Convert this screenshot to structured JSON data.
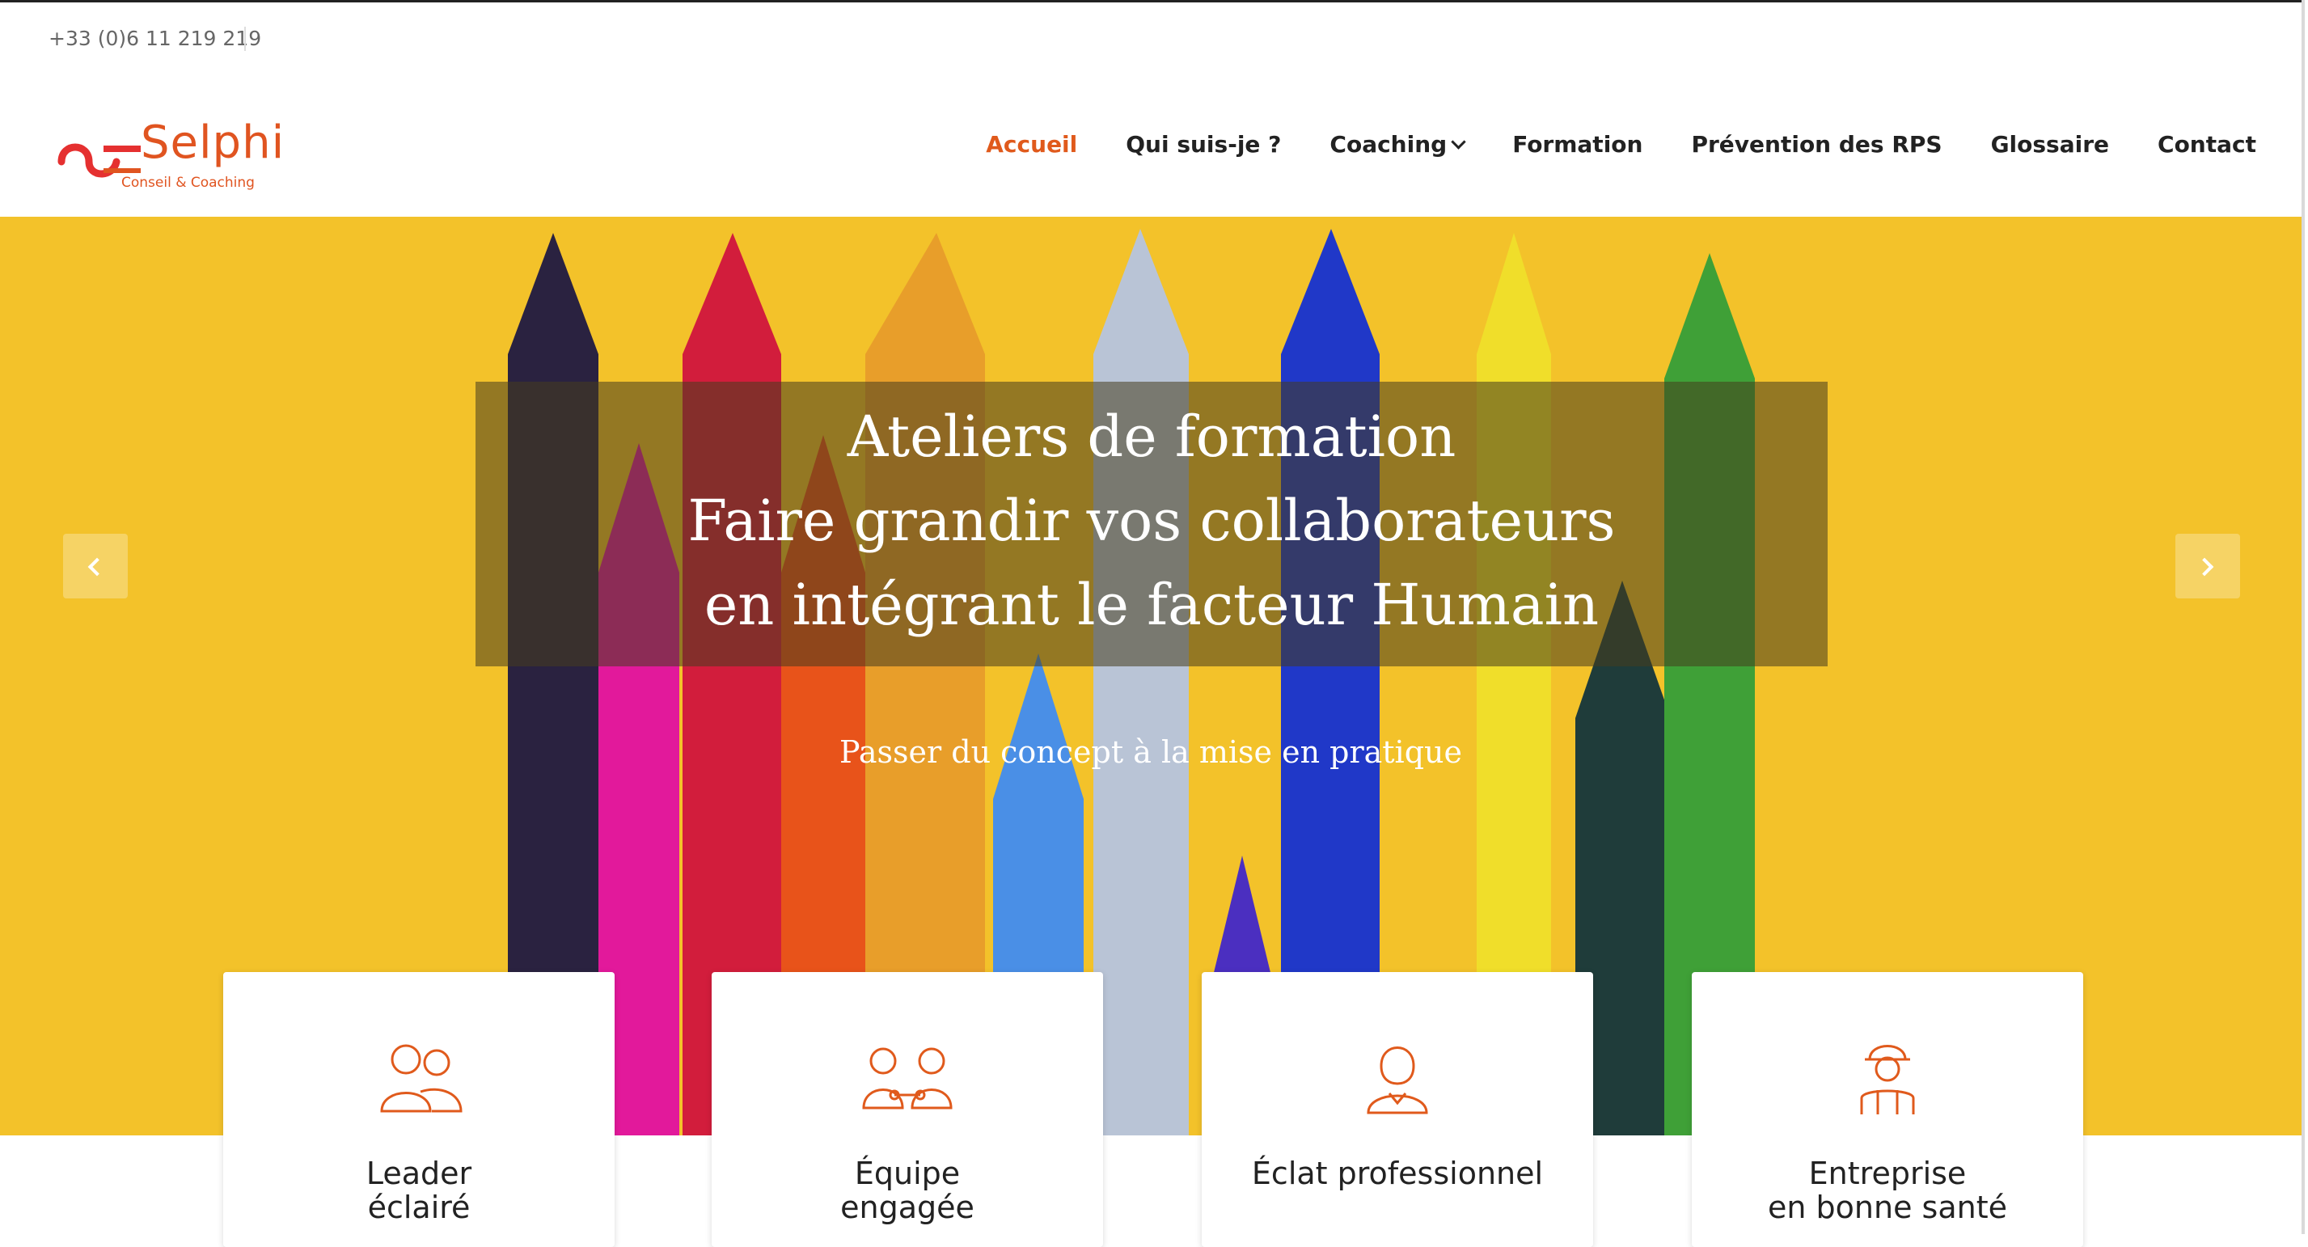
{
  "topbar": {
    "phone": "+33 (0)6 11 219 219"
  },
  "logo": {
    "brand": "Selphi",
    "tagline": "Conseil & Coaching"
  },
  "nav": {
    "items": [
      {
        "label": "Accueil",
        "active": true
      },
      {
        "label": "Qui suis-je ?"
      },
      {
        "label": "Coaching",
        "dropdown": true
      },
      {
        "label": "Formation"
      },
      {
        "label": "Prévention des RPS"
      },
      {
        "label": "Glossaire"
      },
      {
        "label": "Contact"
      }
    ]
  },
  "hero": {
    "title_lines": [
      "Ateliers de formation",
      "Faire grandir vos collaborateurs",
      "en intégrant le facteur Humain"
    ],
    "subtitle": "Passer du concept à la mise en pratique"
  },
  "cards": [
    {
      "title_lines": [
        "Leader",
        "éclairé"
      ],
      "icon": "two-people-icon"
    },
    {
      "title_lines": [
        "Équipe",
        "engagée"
      ],
      "icon": "team-link-icon"
    },
    {
      "title_lines": [
        "Éclat professionnel",
        ""
      ],
      "icon": "woman-icon"
    },
    {
      "title_lines": [
        "Entreprise",
        "en bonne santé"
      ],
      "icon": "worker-helmet-icon"
    }
  ],
  "colors": {
    "accent": "#e05a1c",
    "hero_bg": "#f3c22a"
  }
}
